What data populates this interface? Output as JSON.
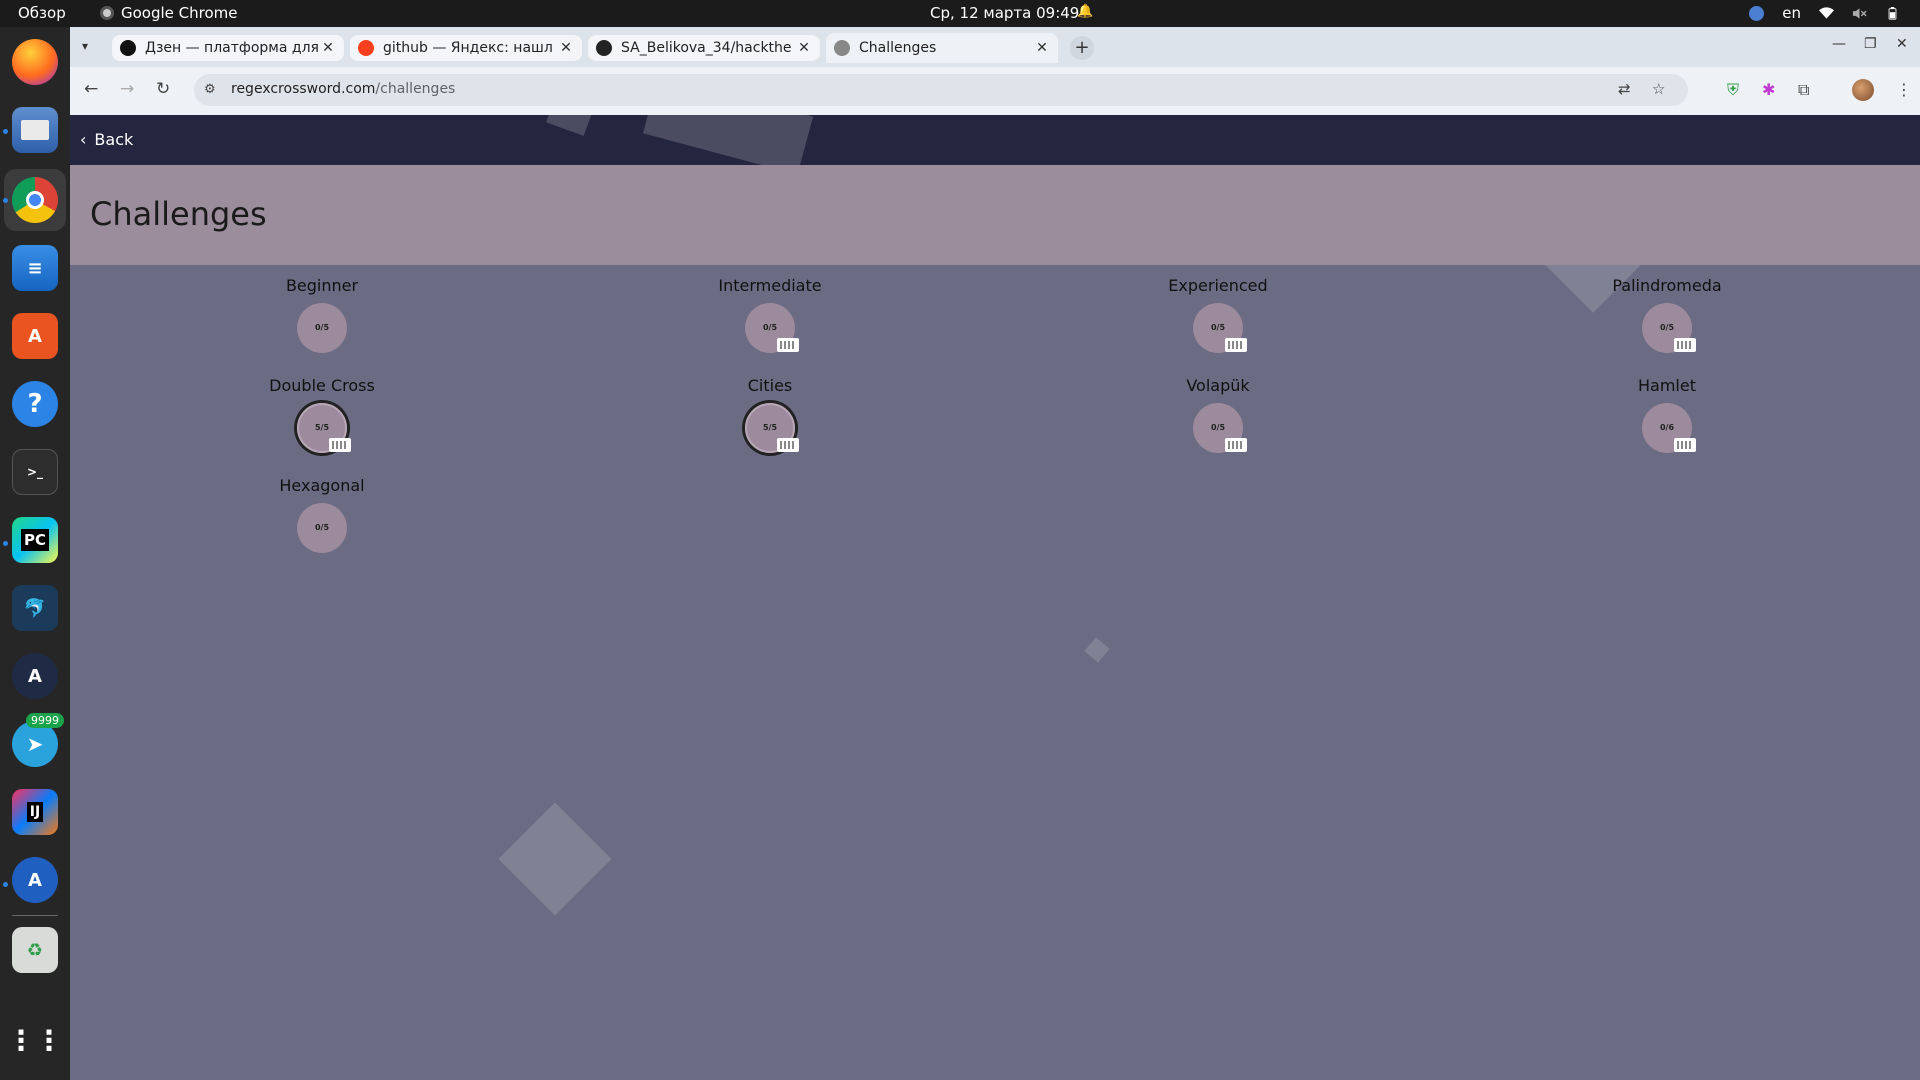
{
  "topbar": {
    "activities": "Обзор",
    "app_name": "Google Chrome",
    "clock": "Ср, 12 марта  09:49",
    "lang": "en"
  },
  "dock": {
    "telegram_badge": "9999",
    "icons": [
      "firefox-icon",
      "files-icon",
      "chrome-icon",
      "writer-icon",
      "app-center-icon",
      "help-icon",
      "terminal-icon",
      "pycharm-icon",
      "mysql-workbench-icon",
      "arch-icon",
      "telegram-icon",
      "intellij-icon",
      "software-updater-icon",
      "trash-icon",
      "app-grid-icon"
    ]
  },
  "browser": {
    "tabs": [
      {
        "title": "Дзен — платформа для",
        "active": false
      },
      {
        "title": "github — Яндекс: нашл",
        "active": false
      },
      {
        "title": "SA_Belikova_34/hackthe",
        "active": false
      },
      {
        "title": "Challenges",
        "active": true
      }
    ],
    "url_host": "regexcrossword.com",
    "url_path": "/challenges"
  },
  "page": {
    "back_label": "Back",
    "title": "Challenges",
    "challenges": [
      {
        "name": "Beginner",
        "progress": "0/5",
        "keyboard": false,
        "completed": false
      },
      {
        "name": "Intermediate",
        "progress": "0/5",
        "keyboard": true,
        "completed": false
      },
      {
        "name": "Experienced",
        "progress": "0/5",
        "keyboard": true,
        "completed": false
      },
      {
        "name": "Palindromeda",
        "progress": "0/5",
        "keyboard": true,
        "completed": false
      },
      {
        "name": "Double Cross",
        "progress": "5/5",
        "keyboard": true,
        "completed": true
      },
      {
        "name": "Cities",
        "progress": "5/5",
        "keyboard": true,
        "completed": true
      },
      {
        "name": "Volapük",
        "progress": "0/5",
        "keyboard": true,
        "completed": false
      },
      {
        "name": "Hamlet",
        "progress": "0/6",
        "keyboard": true,
        "completed": false
      },
      {
        "name": "Hexagonal",
        "progress": "0/5",
        "keyboard": false,
        "completed": false
      }
    ]
  }
}
